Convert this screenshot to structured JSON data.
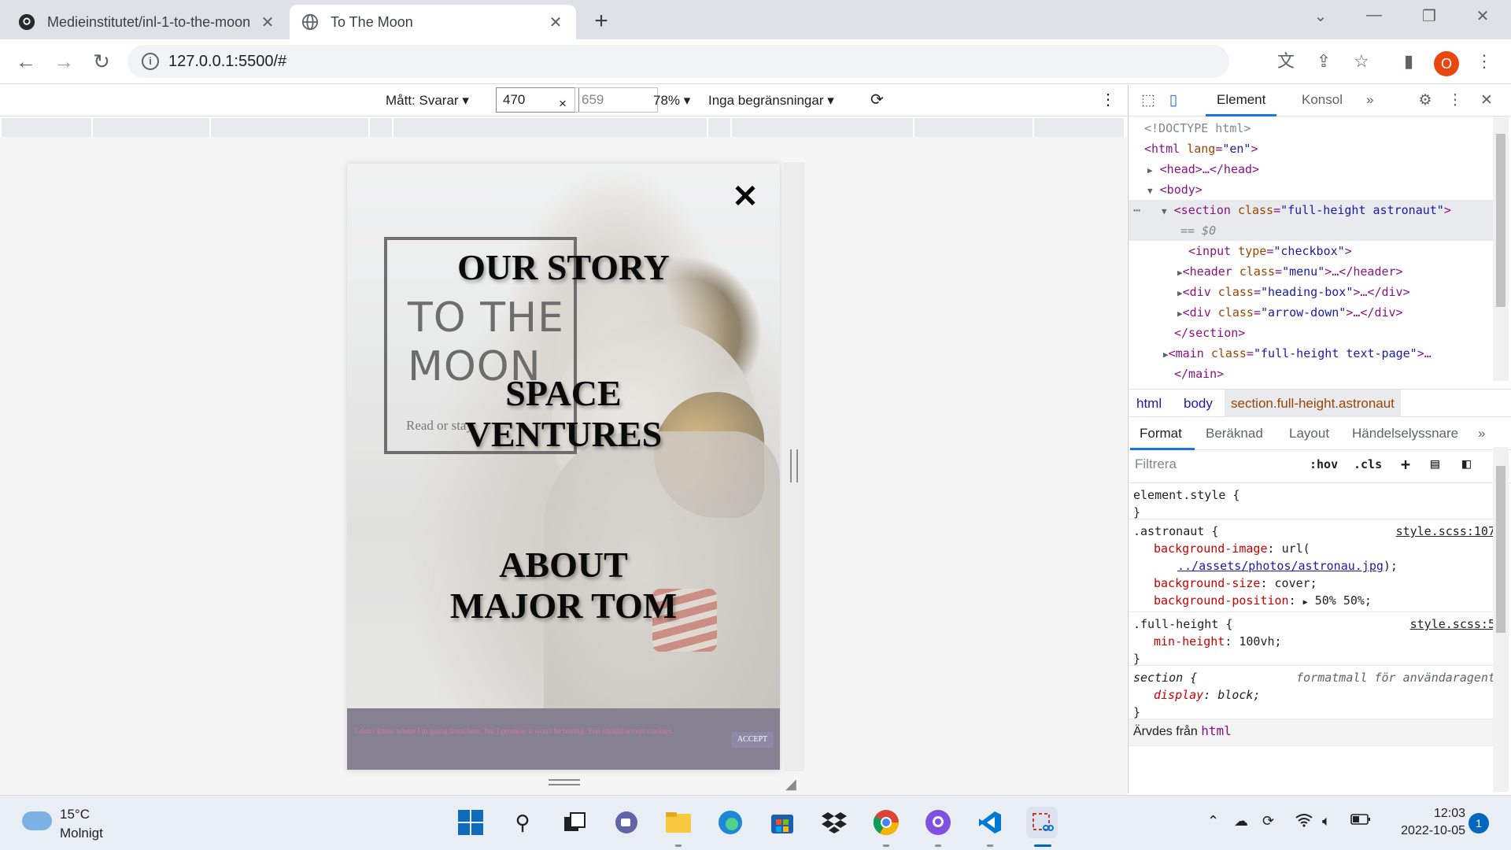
{
  "browser": {
    "tabs": [
      {
        "title": "Medieinstitutet/inl-1-to-the-moon",
        "icon": "github-icon",
        "active": false
      },
      {
        "title": "To The Moon",
        "icon": "globe-icon",
        "active": true
      }
    ],
    "address": {
      "url": "127.0.0.1:5500/#"
    },
    "profile_initial": "O"
  },
  "device_toolbar": {
    "dimensions_label": "Mått: Svarar",
    "width": "470",
    "height": "659",
    "zoom": "78%",
    "throttling": "Inga begränsningar"
  },
  "page": {
    "close_symbol": "✕",
    "heading": "TO THE MOON",
    "heading_line1": "TO THE",
    "heading_line2": "MOON",
    "subtext": "Read or stay",
    "menu": [
      "OUR STORY",
      "SPACE VENTURES",
      "ABOUT MAJOR TOM"
    ],
    "menu_lines": {
      "our_story": "OUR STORY",
      "space_1": "SPACE",
      "space_2": "VENTURES",
      "about_1": "ABOUT",
      "about_2": "MAJOR TOM"
    },
    "cookie": {
      "text": "I don't know where I'm going from here, but I promise it won't be boring. You should accept cookies.",
      "accept": "ACCEPT"
    }
  },
  "devtools": {
    "tabs": [
      "Element",
      "Konsol"
    ],
    "dom": {
      "doctype": "<!DOCTYPE html>",
      "html_open": "<html",
      "html_lang_attr": "lang",
      "html_lang_val": "\"en\"",
      "head": "<head>…</head>",
      "body": "<body>",
      "section_tag": "<section",
      "section_class": "\"full-height astronaut\"",
      "dollar0": "== $0",
      "input_tag": "<input",
      "input_type": "\"checkbox\"",
      "header_tag": "<header",
      "header_class": "\"menu\"",
      "header_close": "…</header>",
      "div1_class": "\"heading-box\"",
      "div2_class": "\"arrow-down\"",
      "div_close": "…</div>",
      "section_close": "</section>",
      "main_tag": "<main",
      "main_class": "\"full-height text-page\"",
      "main_close": "</main>"
    },
    "breadcrumbs": [
      "html",
      "body",
      "section.full-height.astronaut"
    ],
    "subtabs": [
      "Format",
      "Beräknad",
      "Layout",
      "Händelselyssnare"
    ],
    "filter_placeholder": "Filtrera",
    "filter_buttons": [
      ":hov",
      ".cls",
      "+"
    ],
    "styles": {
      "element_style": "element.style {",
      "close_brace": "}",
      "astronaut_selector": ".astronaut {",
      "astronaut_src": "style.scss:107",
      "bg_image_prop": "background-image",
      "bg_image_pre": "url(",
      "bg_image_url": "../assets/photos/astronau.jpg",
      "bg_image_post": ");",
      "bg_size_prop": "background-size",
      "bg_size_val": "cover;",
      "bg_pos_prop": "background-position",
      "bg_pos_val": "50% 50%;",
      "fullheight_selector": ".full-height {",
      "fullheight_src": "style.scss:5",
      "minheight_prop": "min-height",
      "minheight_val": "100vh;",
      "section_selector": "section {",
      "section_src": "formatmall för användaragent",
      "display_prop": "display",
      "display_val": "block;",
      "inherited_label": "Ärvdes från",
      "inherited_tag": "html"
    }
  },
  "taskbar": {
    "weather_temp": "15°C",
    "weather_desc": "Molnigt",
    "time": "12:03",
    "date": "2022-10-05",
    "notifications": "1"
  }
}
